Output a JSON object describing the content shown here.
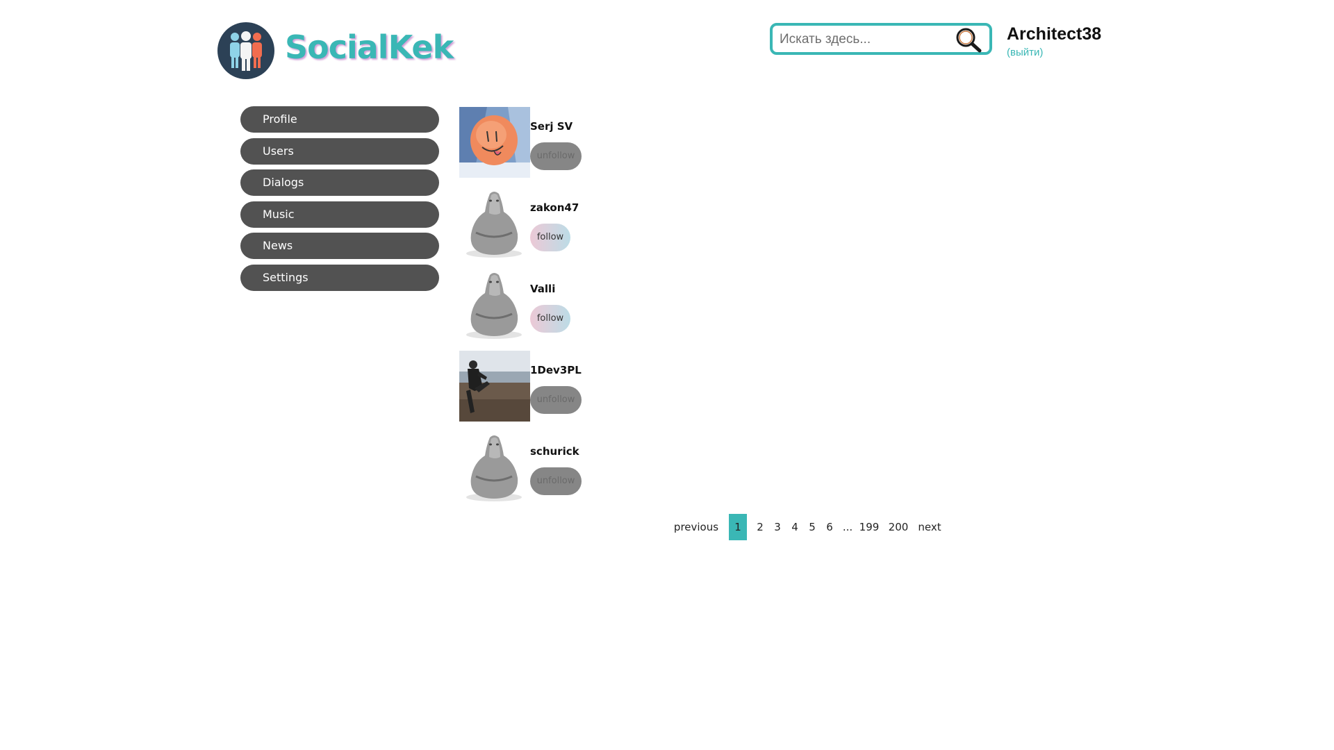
{
  "header": {
    "logo_text": "SocialKek",
    "search_placeholder": "Искать здесь...",
    "user_name": "Architect38",
    "logout_label": "(выйти)"
  },
  "nav": {
    "items": [
      {
        "label": "Profile"
      },
      {
        "label": "Users"
      },
      {
        "label": "Dialogs"
      },
      {
        "label": "Music"
      },
      {
        "label": "News"
      },
      {
        "label": "Settings"
      }
    ]
  },
  "users": [
    {
      "name": "Serj SV",
      "button": "unfollow",
      "avatar": "smiley-photo"
    },
    {
      "name": "zakon47",
      "button": "follow",
      "avatar": "default-figure"
    },
    {
      "name": "Valli",
      "button": "follow",
      "avatar": "default-figure"
    },
    {
      "name": "1Dev3PL",
      "button": "unfollow",
      "avatar": "person-photo"
    },
    {
      "name": "schurick",
      "button": "unfollow",
      "avatar": "default-figure"
    }
  ],
  "pagination": {
    "previous": "previous",
    "pages": [
      "1",
      "2",
      "3",
      "4",
      "5",
      "6"
    ],
    "ellipsis": "...",
    "last_pages": [
      "199",
      "200"
    ],
    "next": "next",
    "current": "1"
  },
  "colors": {
    "accent": "#3ab7b5",
    "nav_bg": "#525252",
    "logo_circle": "#2c4156"
  }
}
